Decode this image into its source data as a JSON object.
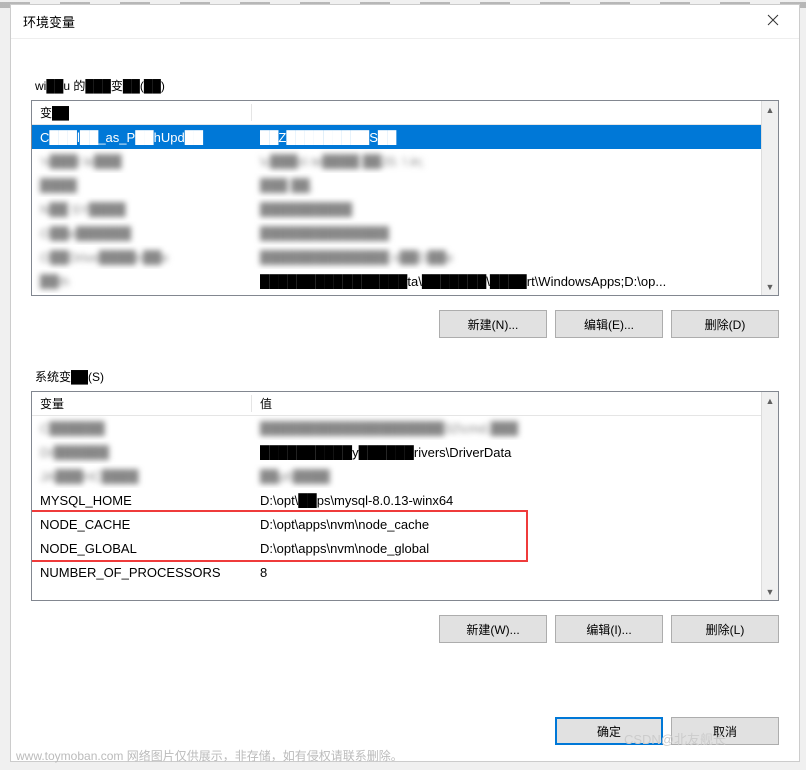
{
  "dialog": {
    "title": "环境变量",
    "close": "✕"
  },
  "user_section": {
    "label": "wi██u 的███变██(██)",
    "headers": {
      "col1": "变██",
      "col2": ""
    },
    "rows": [
      {
        "name": "C███l██_as_P██hUpd██",
        "value": "██Z█████████S██"
      },
      {
        "name": "'n███l le███",
        "value": "\\c███s\\ te████ ██20. \\ in;"
      },
      {
        "name": "████",
        "value": "███ ██."
      },
      {
        "name": "N██ SY████",
        "value": "██████████"
      },
      {
        "name": "O██e██████",
        "value": "██████████████"
      },
      {
        "name": "O██Drive████n██e",
        "value": "██████████████ n██D██e"
      },
      {
        "name": "██th",
        "value": "████████████████ta\\███████\\████rt\\WindowsApps;D:\\op..."
      }
    ],
    "buttons": {
      "new": "新建(N)...",
      "edit": "编辑(E)...",
      "delete": "删除(D)"
    }
  },
  "system_section": {
    "label": "系统变██(S)",
    "headers": {
      "col1": "变量",
      "col2": "值"
    },
    "rows": [
      {
        "name": "C██████",
        "value": "████████████████████32\\cmd.███"
      },
      {
        "name": "Dr██████",
        "value": "██████████y██████rivers\\DriverData"
      },
      {
        "name": "JA███HC████",
        "value": "██pt\\████"
      },
      {
        "name": "MYSQL_HOME",
        "value": "D:\\opt\\██ps\\mysql-8.0.13-winx64"
      },
      {
        "name": "NODE_CACHE",
        "value": "D:\\opt\\apps\\nvm\\node_cache"
      },
      {
        "name": "NODE_GLOBAL",
        "value": "D:\\opt\\apps\\nvm\\node_global"
      },
      {
        "name": "NUMBER_OF_PROCESSORS",
        "value": "8"
      }
    ],
    "buttons": {
      "new": "新建(W)...",
      "edit": "编辑(I)...",
      "delete": "删除(L)"
    }
  },
  "footer": {
    "ok": "确定",
    "cancel": "取消"
  },
  "watermark": {
    "left": "www.toymoban.com   网络图片仅供展示，非存储，如有侵权请联系删除。",
    "right": "CSDN@北友舰长"
  }
}
